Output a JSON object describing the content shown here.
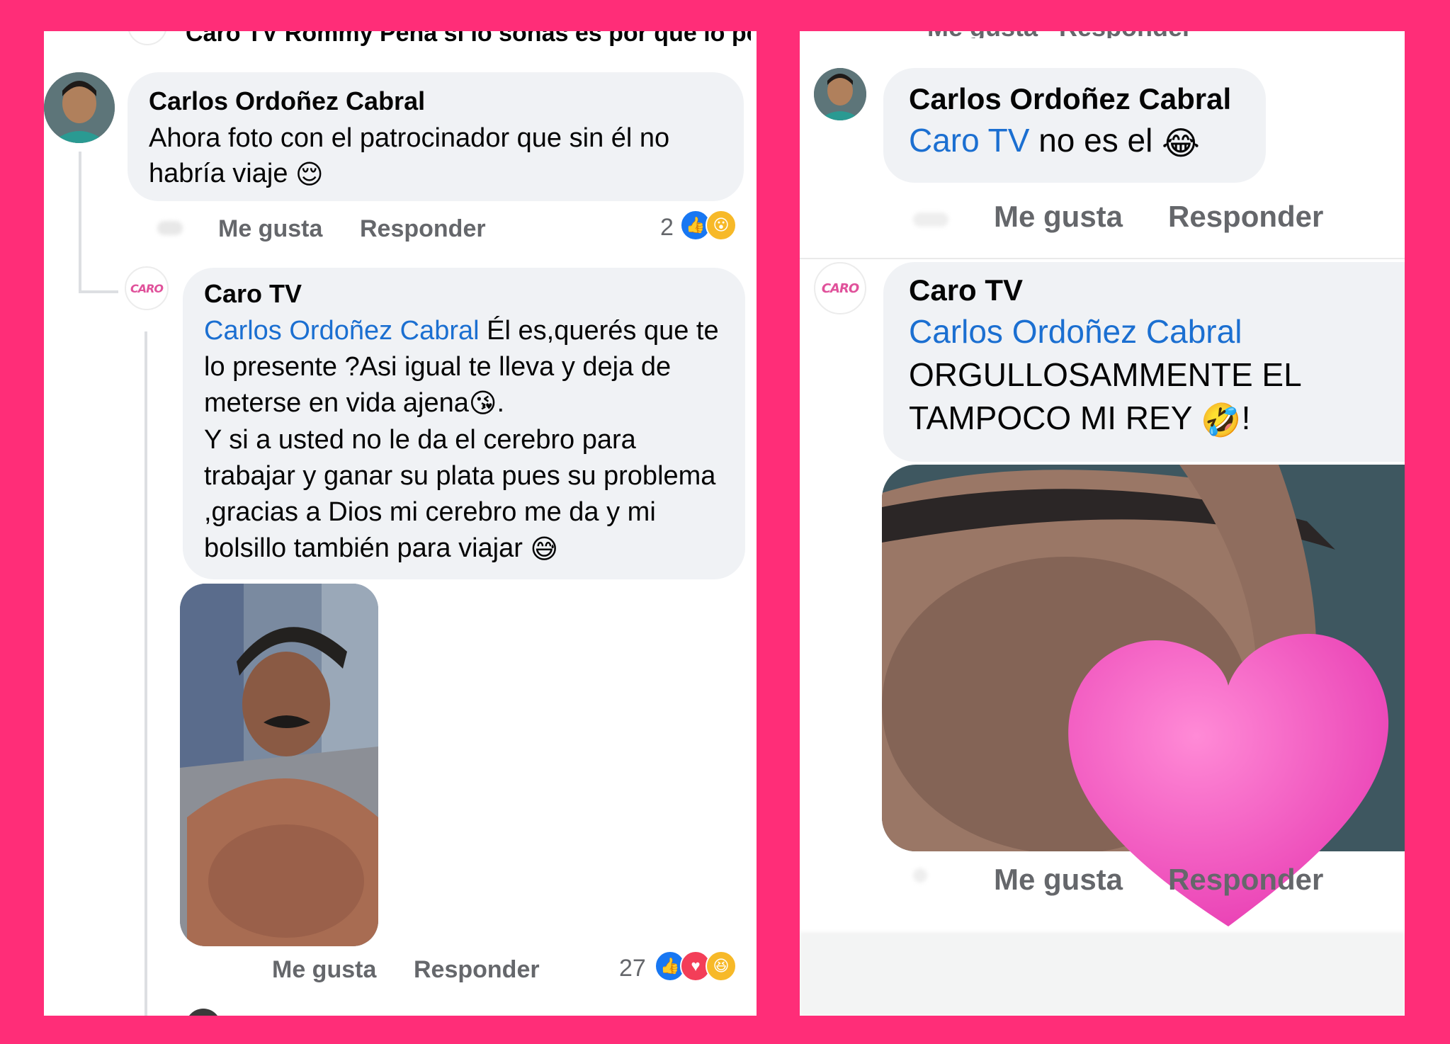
{
  "left": {
    "top_cut_text": "Caro TV  Rommy Peña si lo soñas es por que lo pod...",
    "comment1": {
      "author": "Carlos Ordoñez Cabral",
      "text": "Ahora foto con el patrocinador que sin él no habría viaje",
      "emoji": "😌",
      "like_label": "Me gusta",
      "reply_label": "Responder",
      "reaction_count": "2"
    },
    "reply1": {
      "avatar_text": "CARO",
      "author": "Caro TV",
      "mention": "Carlos Ordoñez Cabral",
      "line1": " Él es,querés que te lo presente ?Asi igual te lleva y deja de meterse en vida ajena",
      "line1_emoji": "😘",
      "line1_end": ".",
      "line2": "Y si a usted no le da el cerebro para trabajar y ganar su plata pues su problema ,gracias a Dios mi cerebro me da y mi bolsillo también para viajar",
      "line2_emoji": "😅",
      "like_label": "Me gusta",
      "reply_label": "Responder",
      "reaction_count": "27"
    }
  },
  "right": {
    "top_cut_text": "Me gusta   Responder",
    "comment1": {
      "author": "Carlos Ordoñez Cabral",
      "mention": "Caro TV",
      "text": " no es el",
      "emoji": "😂",
      "like_label": "Me gusta",
      "reply_label": "Responder"
    },
    "reply1": {
      "avatar_text": "CARO",
      "author": "Caro TV",
      "mention": "Carlos Ordoñez Cabral",
      "line1": "ORGULLOSAMMENTE EL",
      "line2": "TAMPOCO MI REY",
      "emoji": "🤣",
      "end": "!",
      "like_label": "Me gusta",
      "reply_label": "Responder"
    }
  },
  "colors": {
    "frame": "#ff2d78",
    "mention": "#1b6fd1",
    "bubble": "#f0f2f5",
    "like_blue": "#1877f2",
    "heart_red": "#f33e58",
    "haha_yellow": "#f7b928",
    "censor_heart": "#f25ec0"
  },
  "icons": [
    "like-icon",
    "wow-icon",
    "love-icon",
    "haha-icon",
    "censor-heart-icon"
  ]
}
